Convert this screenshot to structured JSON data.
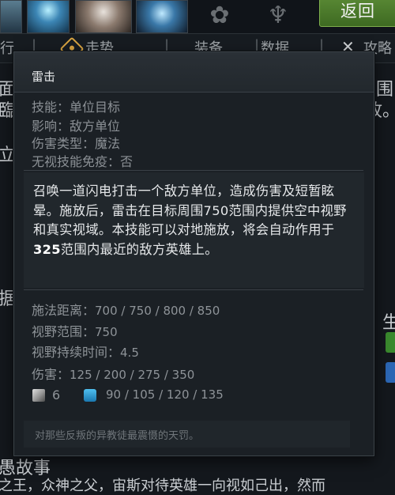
{
  "top": {
    "return_button_label": "返回",
    "heroes": [
      "hero-portrait",
      "hero-portrait",
      "hero-portrait",
      "hero-portrait"
    ]
  },
  "nav": {
    "items": [
      "行",
      "走势",
      "装备",
      "数据",
      "攻略"
    ],
    "separator": "|",
    "close_glyph": "✕"
  },
  "background": {
    "left_fragments": [
      "面",
      "臨",
      "立",
      "据"
    ],
    "right_fragments": [
      "围",
      "故。"
    ],
    "bottom_heading": "愚故事",
    "bottom_line": "之王，众神之父，宙斯对待英雄一向视如己出，然而",
    "right_side": "生"
  },
  "tooltip": {
    "title": "雷击",
    "stats": [
      {
        "label": "技能：",
        "value": "单位目标"
      },
      {
        "label": "影响：",
        "value": "敌方单位"
      },
      {
        "label": "伤害类型：",
        "value": "魔法"
      },
      {
        "label": "无视技能免疫：",
        "value": "否"
      }
    ],
    "description_part1": "召唤一道闪电打击一个敌方单位，造成伤害及短暂眩晕。施放后，雷击在目标周围750范围内提供空中视野和真实视域。本技能可以对地施放，将会自动作用于",
    "description_bold": "325",
    "description_part2": "范围内最近的敌方英雄上。",
    "values": [
      {
        "label": "施法距离：",
        "value": "700 / 750 / 800 / 850"
      },
      {
        "label": "视野范围：",
        "value": "750"
      },
      {
        "label": "视野持续时间：",
        "value": "4.5"
      },
      {
        "label": "伤害：",
        "value": "125 / 200 / 275 / 350"
      }
    ],
    "cooldown": "6",
    "mana": "90 / 105 / 120 / 135",
    "lore": "对那些反叛的异教徒最震慑的天罚。"
  },
  "colors": {
    "accent_green": "#4e7f2d",
    "tooltip_bg": "#1b2025",
    "mana_blue": "#2a98d4"
  }
}
